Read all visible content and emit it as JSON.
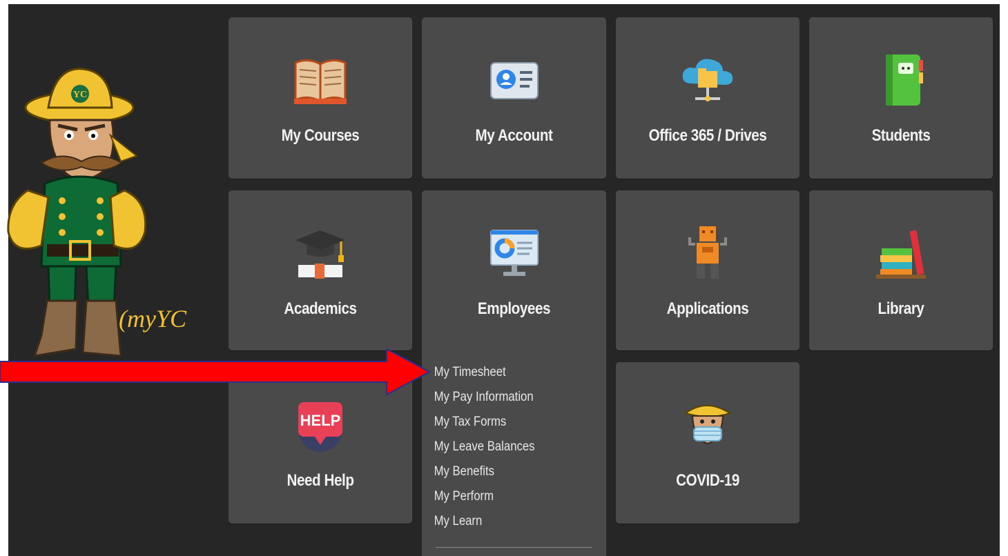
{
  "portal": {
    "logo_text": "myYC",
    "tiles": [
      {
        "label": "My Courses",
        "icon": "open-book-icon"
      },
      {
        "label": "My Account",
        "icon": "id-card-icon"
      },
      {
        "label": "Office 365 / Drives",
        "icon": "cloud-folder-icon"
      },
      {
        "label": "Students",
        "icon": "green-notebook-icon"
      },
      {
        "label": "Academics",
        "icon": "graduation-cap-diploma-icon"
      },
      {
        "label": "Employees",
        "icon": "monitor-chart-icon"
      },
      {
        "label": "Applications",
        "icon": "robot-icon"
      },
      {
        "label": "Library",
        "icon": "book-stack-icon"
      },
      {
        "label": "Need Help",
        "icon": "help-sign-icon"
      },
      {
        "label": "COVID-19",
        "icon": "masked-mascot-icon"
      }
    ],
    "employees_menu": [
      "My Timesheet",
      "My Pay Information",
      "My Tax Forms",
      "My Leave Balances",
      "My Benefits",
      "My Perform",
      "My Learn"
    ],
    "help_badge": "HELP"
  },
  "colors": {
    "page_background": "#262626",
    "tile_background": "#4a4a4a",
    "label_color": "#f2f2f2",
    "arrow_red": "#ff0000",
    "arrow_outline": "#2a2f8f"
  }
}
